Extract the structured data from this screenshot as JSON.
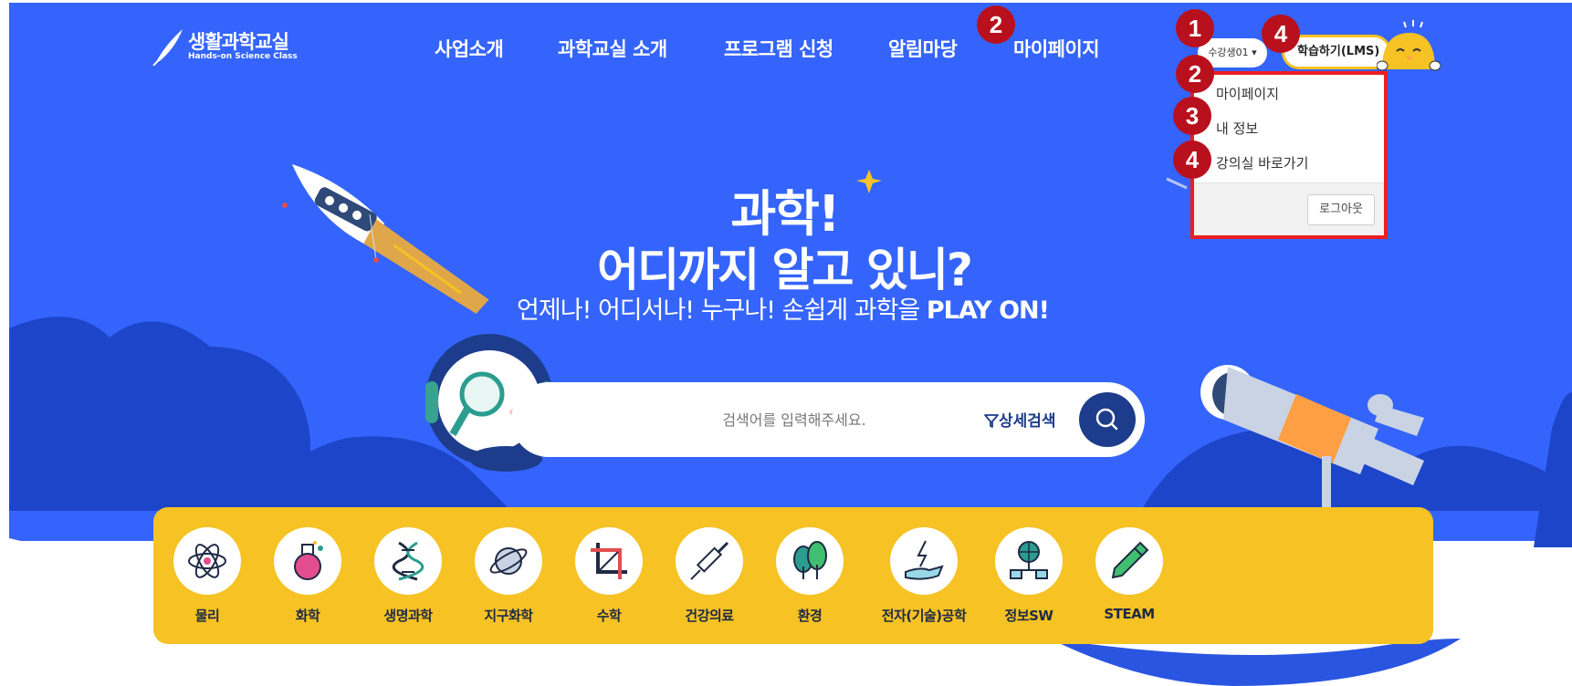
{
  "logo": {
    "title": "생활과학교실",
    "subtitle": "Hands-on Science Class"
  },
  "nav": [
    "사업소개",
    "과학교실 소개",
    "프로그램 신청",
    "알림마당",
    "마이페이지"
  ],
  "user": {
    "name": "수강생01 ▾"
  },
  "lms_button": "학습하기(LMS)",
  "dropdown": {
    "items": [
      "마이페이지",
      "내 정보",
      "강의실 바로가기"
    ],
    "logout": "로그아웃"
  },
  "badges": [
    "1",
    "2",
    "2",
    "3",
    "4",
    "4"
  ],
  "hero": {
    "title_line1": "과학!",
    "title_line2": "어디까지 알고 있니?",
    "subtitle": "언제나! 어디서나! 누구나! 손쉽게 과학을 ",
    "subtitle_bold": "PLAY ON!"
  },
  "search": {
    "placeholder": "검색어를 입력해주세요.",
    "advanced": "상세검색"
  },
  "categories": [
    {
      "label": "물리",
      "icon": "atom-icon"
    },
    {
      "label": "화학",
      "icon": "flask-icon"
    },
    {
      "label": "생명과학",
      "icon": "dna-icon"
    },
    {
      "label": "지구화학",
      "icon": "planet-icon"
    },
    {
      "label": "수학",
      "icon": "crop-tool-icon"
    },
    {
      "label": "건강의료",
      "icon": "syringe-icon"
    },
    {
      "label": "환경",
      "icon": "trees-icon"
    },
    {
      "label": "전자(기술)공학",
      "icon": "hand-lightning-icon"
    },
    {
      "label": "정보SW",
      "icon": "network-globe-icon"
    },
    {
      "label": "STEAM",
      "icon": "pencil-icon"
    }
  ],
  "colors": {
    "hero_blue": "#3464fb",
    "dark_blue": "#1d3c8b",
    "yellow": "#f6c224",
    "highlight_red": "#ee1d23",
    "badge_red": "#b8101d"
  }
}
